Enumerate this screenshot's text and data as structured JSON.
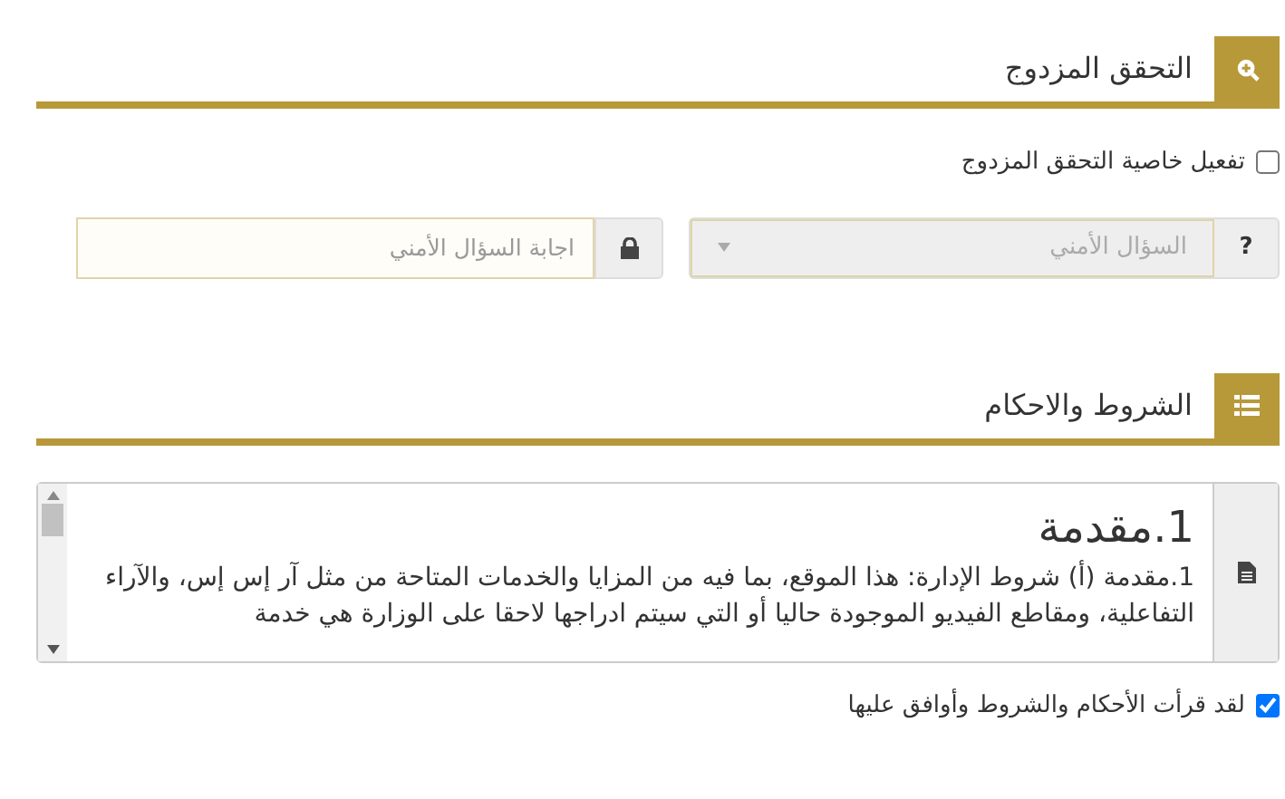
{
  "sections": [
    {
      "kind": "security",
      "title": "التحقق المزدوج",
      "enable_2fa": {
        "label": "تفعيل خاصية التحقق المزدوج",
        "checked": false
      },
      "question": {
        "addon": "?",
        "placeholder": "السؤال الأمني",
        "disabled": true
      },
      "answer": {
        "placeholder": "اجابة السؤال الأمني"
      }
    },
    {
      "kind": "terms",
      "title": "الشروط والاحكام",
      "terms_heading": "1.مقدمة",
      "terms_text": "1.مقدمة (أ) شروط الإدارة: هذا الموقع، بما فيه من المزايا والخدمات المتاحة من مثل آر إس إس، والآراء التفاعلية، ومقاطع الفيديو الموجودة حاليا أو التي سيتم ادراجها لاحقا على الوزارة هي خدمة",
      "agree": {
        "label": "لقد قرأت الأحكام والشروط وأوافق عليها",
        "checked": true
      }
    }
  ]
}
